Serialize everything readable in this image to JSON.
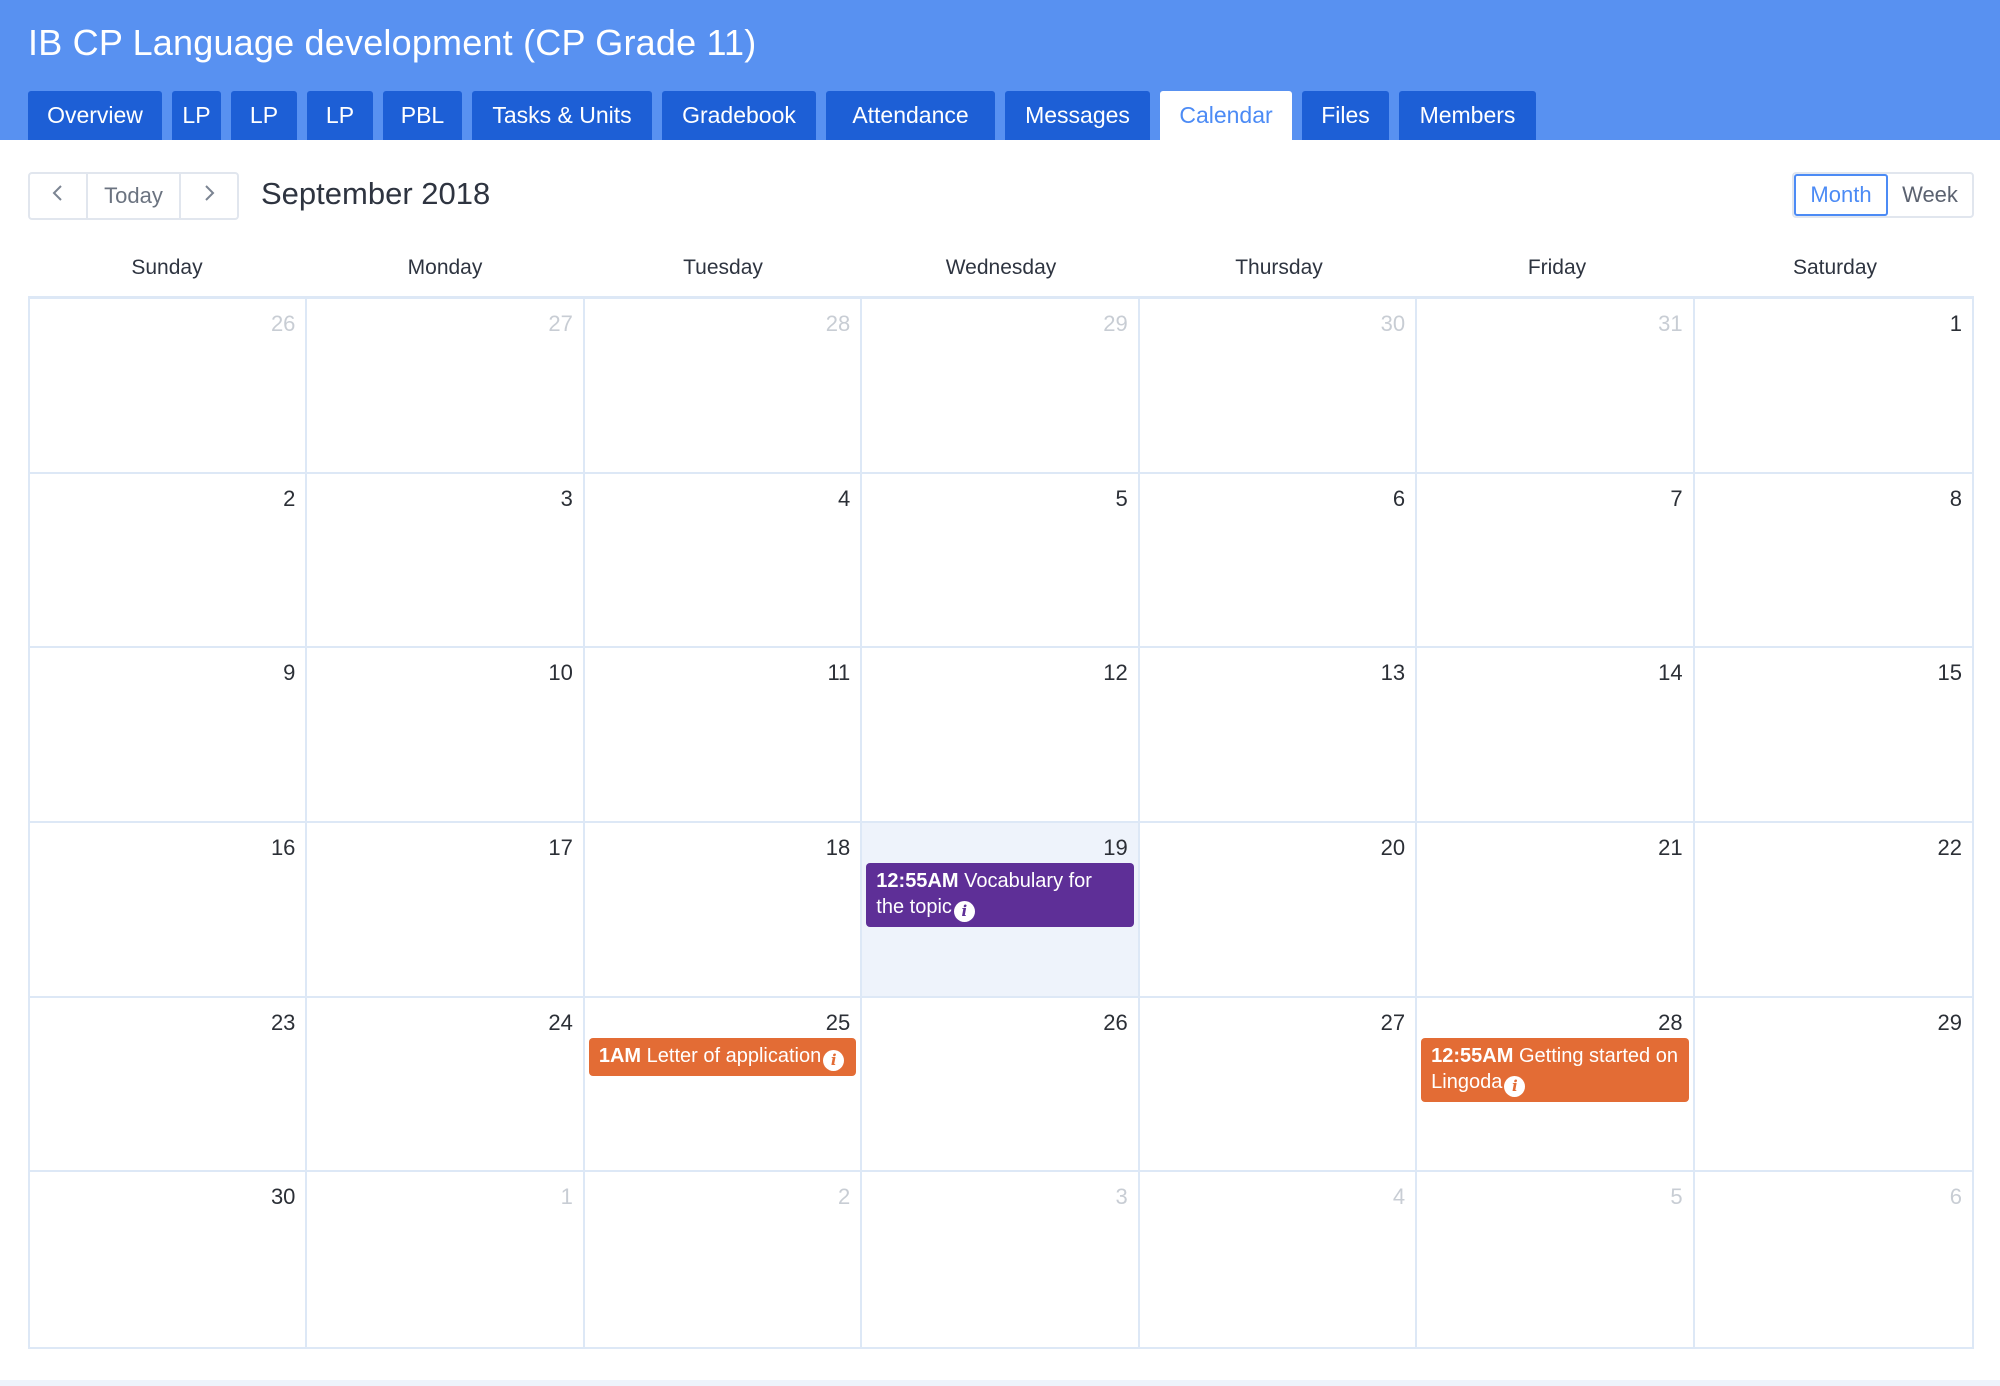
{
  "course": {
    "title": "IB CP Language development (CP Grade 11)"
  },
  "tabs": [
    {
      "label": "Overview",
      "active": false
    },
    {
      "label": "LP",
      "active": false
    },
    {
      "label": "LP",
      "active": false
    },
    {
      "label": "LP",
      "active": false
    },
    {
      "label": "PBL",
      "active": false
    },
    {
      "label": "Tasks & Units",
      "active": false
    },
    {
      "label": "Gradebook",
      "active": false
    },
    {
      "label": "Attendance",
      "active": false
    },
    {
      "label": "Messages",
      "active": false
    },
    {
      "label": "Calendar",
      "active": true
    },
    {
      "label": "Files",
      "active": false
    },
    {
      "label": "Members",
      "active": false
    }
  ],
  "toolbar": {
    "prev_icon": "chevron-left-icon",
    "today_label": "Today",
    "next_icon": "chevron-right-icon",
    "month_label": "September 2018",
    "view_month_label": "Month",
    "view_week_label": "Week",
    "active_view": "Month"
  },
  "weekdays": [
    "Sunday",
    "Monday",
    "Tuesday",
    "Wednesday",
    "Thursday",
    "Friday",
    "Saturday"
  ],
  "calendar": {
    "today": 19,
    "weeks": [
      [
        {
          "d": "26",
          "other": true
        },
        {
          "d": "27",
          "other": true
        },
        {
          "d": "28",
          "other": true
        },
        {
          "d": "29",
          "other": true
        },
        {
          "d": "30",
          "other": true
        },
        {
          "d": "31",
          "other": true
        },
        {
          "d": "1",
          "other": false
        }
      ],
      [
        {
          "d": "2",
          "other": false
        },
        {
          "d": "3",
          "other": false
        },
        {
          "d": "4",
          "other": false
        },
        {
          "d": "5",
          "other": false
        },
        {
          "d": "6",
          "other": false
        },
        {
          "d": "7",
          "other": false
        },
        {
          "d": "8",
          "other": false
        }
      ],
      [
        {
          "d": "9",
          "other": false
        },
        {
          "d": "10",
          "other": false
        },
        {
          "d": "11",
          "other": false
        },
        {
          "d": "12",
          "other": false
        },
        {
          "d": "13",
          "other": false
        },
        {
          "d": "14",
          "other": false
        },
        {
          "d": "15",
          "other": false
        }
      ],
      [
        {
          "d": "16",
          "other": false
        },
        {
          "d": "17",
          "other": false
        },
        {
          "d": "18",
          "other": false
        },
        {
          "d": "19",
          "other": false,
          "today": true
        },
        {
          "d": "20",
          "other": false
        },
        {
          "d": "21",
          "other": false
        },
        {
          "d": "22",
          "other": false
        }
      ],
      [
        {
          "d": "23",
          "other": false
        },
        {
          "d": "24",
          "other": false
        },
        {
          "d": "25",
          "other": false
        },
        {
          "d": "26",
          "other": false
        },
        {
          "d": "27",
          "other": false
        },
        {
          "d": "28",
          "other": false
        },
        {
          "d": "29",
          "other": false
        }
      ],
      [
        {
          "d": "30",
          "other": false
        },
        {
          "d": "1",
          "other": true
        },
        {
          "d": "2",
          "other": true
        },
        {
          "d": "3",
          "other": true
        },
        {
          "d": "4",
          "other": true
        },
        {
          "d": "5",
          "other": true
        },
        {
          "d": "6",
          "other": true
        }
      ]
    ],
    "events": [
      {
        "day": "19",
        "time": "12:55AM",
        "title": "Vocabulary for the topic",
        "color": "#5e2f97",
        "icon": "info-icon"
      },
      {
        "day": "25",
        "time": "1AM",
        "title": "Letter of application",
        "color": "#e36c35",
        "icon": "info-icon"
      },
      {
        "day": "28",
        "time": "12:55AM",
        "title": "Getting started on Lingoda",
        "color": "#e36c35",
        "icon": "info-icon"
      }
    ]
  },
  "colors": {
    "header_bg": "#5891f1",
    "tab_bg": "#1d5fd6",
    "accent": "#4c8bf5",
    "today_bg": "#eef3fb"
  }
}
